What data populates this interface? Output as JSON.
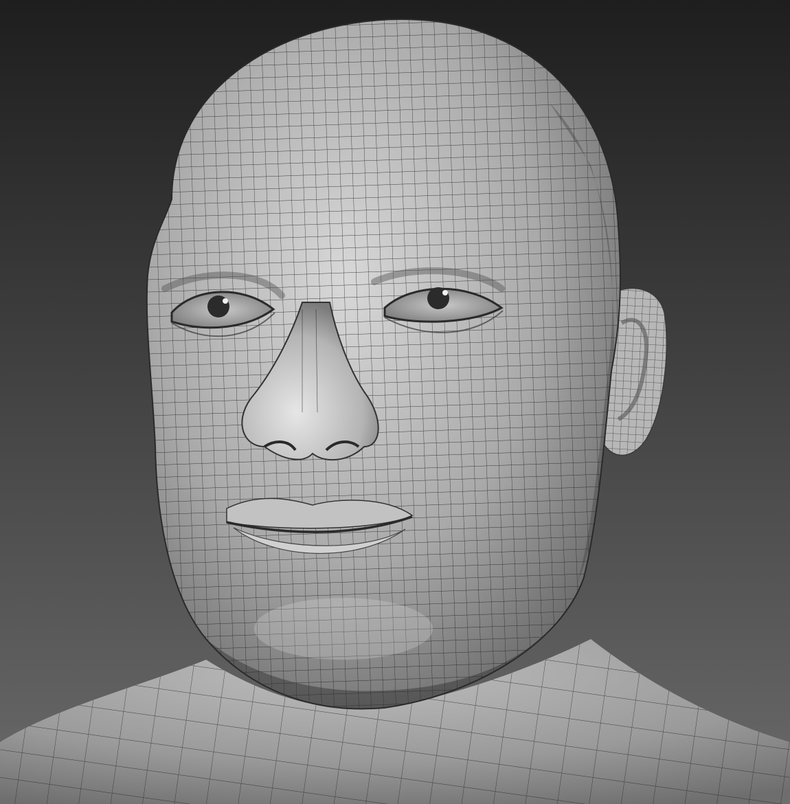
{
  "scene": {
    "background_top": "#1e1e1e",
    "background_bottom": "#6a6a6a",
    "skin_light": "#d8d8d8",
    "skin_mid": "#a9a9a9",
    "skin_dark": "#5c5c5c",
    "wire_color": "#222222",
    "iris_color": "#2b2b2b"
  }
}
